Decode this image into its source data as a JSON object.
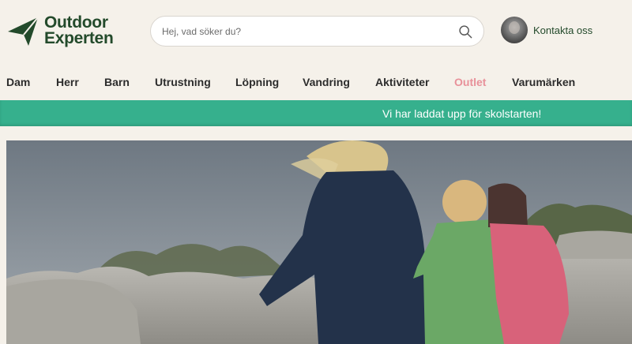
{
  "brand": {
    "logo_line1": "Outdoor",
    "logo_line2": "Experten",
    "color": "#234a2b"
  },
  "search": {
    "placeholder": "Hej, vad söker du?"
  },
  "contact": {
    "label": "Kontakta oss"
  },
  "nav": {
    "items": [
      "Dam",
      "Herr",
      "Barn",
      "Utrustning",
      "Löpning",
      "Vandring",
      "Aktiviteter",
      "Outlet",
      "Varumärken"
    ],
    "highlight_item": "Outlet",
    "highlight_color": "#e8919a"
  },
  "banner": {
    "text": "Vi har laddat upp för skolstarten!",
    "color": "#36b08d"
  },
  "hero": {
    "alt": "Tre barn i fleecejackor springer på klippor vid havet"
  }
}
